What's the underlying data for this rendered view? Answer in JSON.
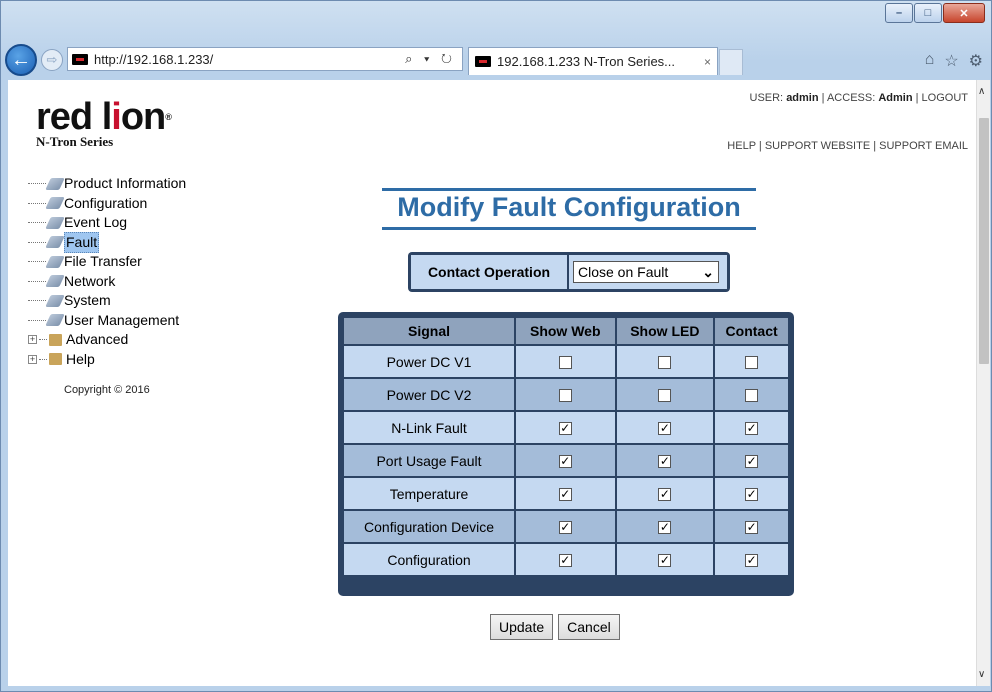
{
  "browser": {
    "address": "http://192.168.1.233/",
    "address_icons": "⌕ ▾ ↻",
    "tab_title": "192.168.1.233 N-Tron Series...",
    "tab_close": "×",
    "back_icon": "back-arrow-icon",
    "forward_icon": "forward-arrow-icon",
    "window_buttons": [
      "–",
      "□",
      "✕"
    ],
    "toolbar_icons": [
      "⌂",
      "☆",
      "⚙"
    ]
  },
  "logo": {
    "part1": "red l",
    "part2": "i",
    "part3": "on",
    "tm": "®",
    "subtitle": "N-Tron Series"
  },
  "header": {
    "user_prefix": "USER:",
    "user": "admin",
    "access_prefix": "| ACCESS:",
    "access": "Admin",
    "logout": "| LOGOUT",
    "help": "HELP",
    "support_website": "SUPPORT WEBSITE",
    "support_email": "SUPPORT EMAIL",
    "sep": "|"
  },
  "sidebar": {
    "items": [
      {
        "label": "Product Information"
      },
      {
        "label": "Configuration"
      },
      {
        "label": "Event Log"
      },
      {
        "label": "Fault"
      },
      {
        "label": "File Transfer"
      },
      {
        "label": "Network"
      },
      {
        "label": "System"
      },
      {
        "label": "User Management"
      }
    ],
    "folders": [
      {
        "label": "Advanced",
        "toggle": "+"
      },
      {
        "label": "Help",
        "toggle": "+"
      }
    ],
    "copyright": "Copyright © 2016"
  },
  "main": {
    "title": "Modify Fault Configuration",
    "contact_operation": {
      "label": "Contact Operation",
      "value": "Close on Fault",
      "arrow": "⌄"
    },
    "table": {
      "headers": [
        "Signal",
        "Show Web",
        "Show LED",
        "Contact"
      ],
      "rows": [
        {
          "signal": "Power DC V1",
          "web": "",
          "led": "",
          "contact": ""
        },
        {
          "signal": "Power DC V2",
          "web": "",
          "led": "",
          "contact": ""
        },
        {
          "signal": "N-Link Fault",
          "web": "✓",
          "led": "✓",
          "contact": "✓"
        },
        {
          "signal": "Port Usage Fault",
          "web": "✓",
          "led": "✓",
          "contact": "✓"
        },
        {
          "signal": "Temperature",
          "web": "✓",
          "led": "✓",
          "contact": "✓"
        },
        {
          "signal": "Configuration Device",
          "web": "✓",
          "led": "✓",
          "contact": "✓"
        },
        {
          "signal": "Configuration",
          "web": "✓",
          "led": "✓",
          "contact": "✓"
        }
      ]
    },
    "buttons": {
      "update": "Update",
      "cancel": "Cancel"
    }
  },
  "scrollbar": {
    "up": "∧",
    "down": "∨"
  }
}
